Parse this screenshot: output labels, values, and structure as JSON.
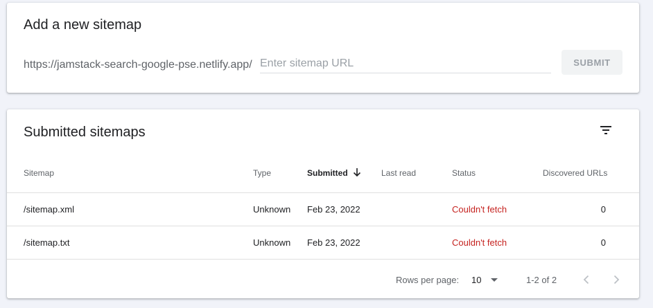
{
  "add_sitemap": {
    "title": "Add a new sitemap",
    "url_prefix": "https://jamstack-search-google-pse.netlify.app/",
    "input_placeholder": "Enter sitemap URL",
    "input_value": "",
    "submit_label": "SUBMIT"
  },
  "submitted": {
    "title": "Submitted sitemaps",
    "filter_icon": "filter-list-icon",
    "columns": {
      "sitemap": "Sitemap",
      "type": "Type",
      "submitted": "Submitted",
      "last_read": "Last read",
      "status": "Status",
      "discovered_urls": "Discovered URLs"
    },
    "sort_icon": "arrow-down-icon",
    "rows": [
      {
        "sitemap": "/sitemap.xml",
        "type": "Unknown",
        "submitted": "Feb 23, 2022",
        "last_read": "",
        "status": "Couldn't fetch",
        "discovered_urls": "0"
      },
      {
        "sitemap": "/sitemap.txt",
        "type": "Unknown",
        "submitted": "Feb 23, 2022",
        "last_read": "",
        "status": "Couldn't fetch",
        "discovered_urls": "0"
      }
    ],
    "pagination": {
      "rows_per_page_label": "Rows per page:",
      "rows_per_page_value": "10",
      "range": "1-2 of 2"
    }
  },
  "colors": {
    "background": "#f1f3f9",
    "error_status": "#c5221f",
    "muted_text": "#5f6368"
  }
}
